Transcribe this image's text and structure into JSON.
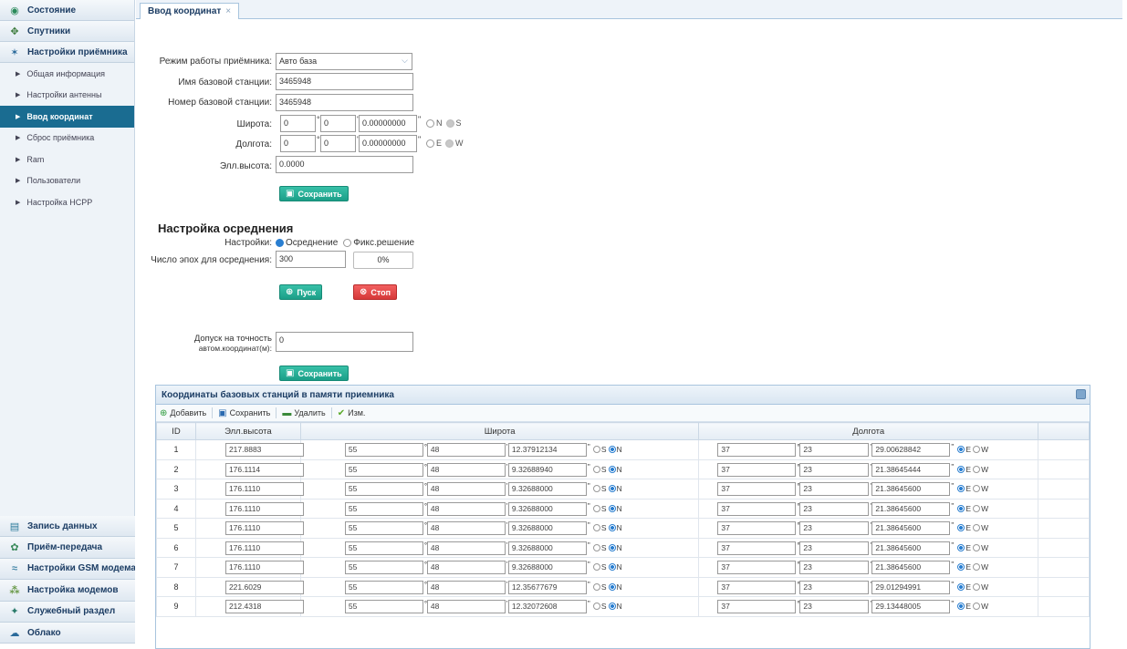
{
  "sidebar": {
    "top_sections": [
      {
        "label": "Состояние",
        "icon": "status-icon"
      },
      {
        "label": "Спутники",
        "icon": "satellite-icon"
      },
      {
        "label": "Настройки приёмника",
        "icon": "tools-icon"
      }
    ],
    "sub_items": [
      {
        "label": "Общая информация"
      },
      {
        "label": "Настройки антенны"
      },
      {
        "label": "Ввод координат"
      },
      {
        "label": "Сброс приёмника"
      },
      {
        "label": "Ram"
      },
      {
        "label": "Пользователи"
      },
      {
        "label": "Настройка НСРР"
      }
    ],
    "bottom_sections": [
      {
        "label": "Запись данных",
        "icon": "data-icon"
      },
      {
        "label": "Приём-передача",
        "icon": "transfer-icon"
      },
      {
        "label": "Настройки GSM модема",
        "icon": "wifi-icon"
      },
      {
        "label": "Настройка модемов",
        "icon": "modem-icon"
      },
      {
        "label": "Служебный раздел",
        "icon": "service-icon"
      },
      {
        "label": "Облако",
        "icon": "cloud-icon"
      }
    ]
  },
  "tab": {
    "label": "Ввод координат",
    "close": "×"
  },
  "form": {
    "mode_label": "Режим работы приёмника:",
    "mode_value": "Авто база",
    "base_name_label": "Имя базовой станции:",
    "base_name_value": "3465948",
    "base_number_label": "Номер базовой станции:",
    "base_number_value": "3465948",
    "lat_label": "Широта:",
    "lat_deg": "0",
    "lat_min": "0",
    "lat_sec": "0.00000000",
    "lat_n": "N",
    "lat_s": "S",
    "lon_label": "Долгота:",
    "lon_deg": "0",
    "lon_min": "0",
    "lon_sec": "0.00000000",
    "lon_e": "E",
    "lon_w": "W",
    "height_label": "Элл.высота:",
    "height_value": "0.0000",
    "save_label": "Сохранить"
  },
  "averaging": {
    "title": "Настройка осреднения",
    "settings_label": "Настройки:",
    "opt_average": "Осреднение",
    "opt_fixed": "Фикс.решение",
    "epochs_label": "Число эпох для осреднения:",
    "epochs_value": "300",
    "progress_text": "0%",
    "progress": 0,
    "start_label": "Пуск",
    "stop_label": "Стоп"
  },
  "tolerance": {
    "label_line1": "Допуск на точность",
    "label_line2": "автом.координат(м):",
    "value": "0",
    "save_label": "Сохранить"
  },
  "grid": {
    "title": "Координаты базовых станций в памяти приемника",
    "toolbar": {
      "add": "Добавить",
      "save": "Сохранить",
      "delete": "Удалить",
      "edit": "Изм."
    },
    "headers": {
      "id": "ID",
      "height": "Элл.высота",
      "lat": "Широта",
      "lon": "Долгота"
    },
    "rows": [
      {
        "id": "1",
        "h": "217.8883",
        "lat_d": "55",
        "lat_m": "48",
        "lat_s": "12.37912134",
        "lon_d": "37",
        "lon_m": "23",
        "lon_s": "29.00628842"
      },
      {
        "id": "2",
        "h": "176.1114",
        "lat_d": "55",
        "lat_m": "48",
        "lat_s": "9.32688940",
        "lon_d": "37",
        "lon_m": "23",
        "lon_s": "21.38645444"
      },
      {
        "id": "3",
        "h": "176.1110",
        "lat_d": "55",
        "lat_m": "48",
        "lat_s": "9.32688000",
        "lon_d": "37",
        "lon_m": "23",
        "lon_s": "21.38645600"
      },
      {
        "id": "4",
        "h": "176.1110",
        "lat_d": "55",
        "lat_m": "48",
        "lat_s": "9.32688000",
        "lon_d": "37",
        "lon_m": "23",
        "lon_s": "21.38645600"
      },
      {
        "id": "5",
        "h": "176.1110",
        "lat_d": "55",
        "lat_m": "48",
        "lat_s": "9.32688000",
        "lon_d": "37",
        "lon_m": "23",
        "lon_s": "21.38645600"
      },
      {
        "id": "6",
        "h": "176.1110",
        "lat_d": "55",
        "lat_m": "48",
        "lat_s": "9.32688000",
        "lon_d": "37",
        "lon_m": "23",
        "lon_s": "21.38645600"
      },
      {
        "id": "7",
        "h": "176.1110",
        "lat_d": "55",
        "lat_m": "48",
        "lat_s": "9.32688000",
        "lon_d": "37",
        "lon_m": "23",
        "lon_s": "21.38645600"
      },
      {
        "id": "8",
        "h": "221.6029",
        "lat_d": "55",
        "lat_m": "48",
        "lat_s": "12.35677679",
        "lon_d": "37",
        "lon_m": "23",
        "lon_s": "29.01294991"
      },
      {
        "id": "9",
        "h": "212.4318",
        "lat_d": "55",
        "lat_m": "48",
        "lat_s": "12.32072608",
        "lon_d": "37",
        "lon_m": "23",
        "lon_s": "29.13448005"
      }
    ],
    "s_label": "S",
    "n_label": "N",
    "e_label": "E",
    "w_label": "W"
  },
  "colors": {
    "active_item": "#1a6c91",
    "teal_button": "#1b9f88",
    "red_button": "#d63838",
    "radio_on": "#2a7fd1"
  }
}
